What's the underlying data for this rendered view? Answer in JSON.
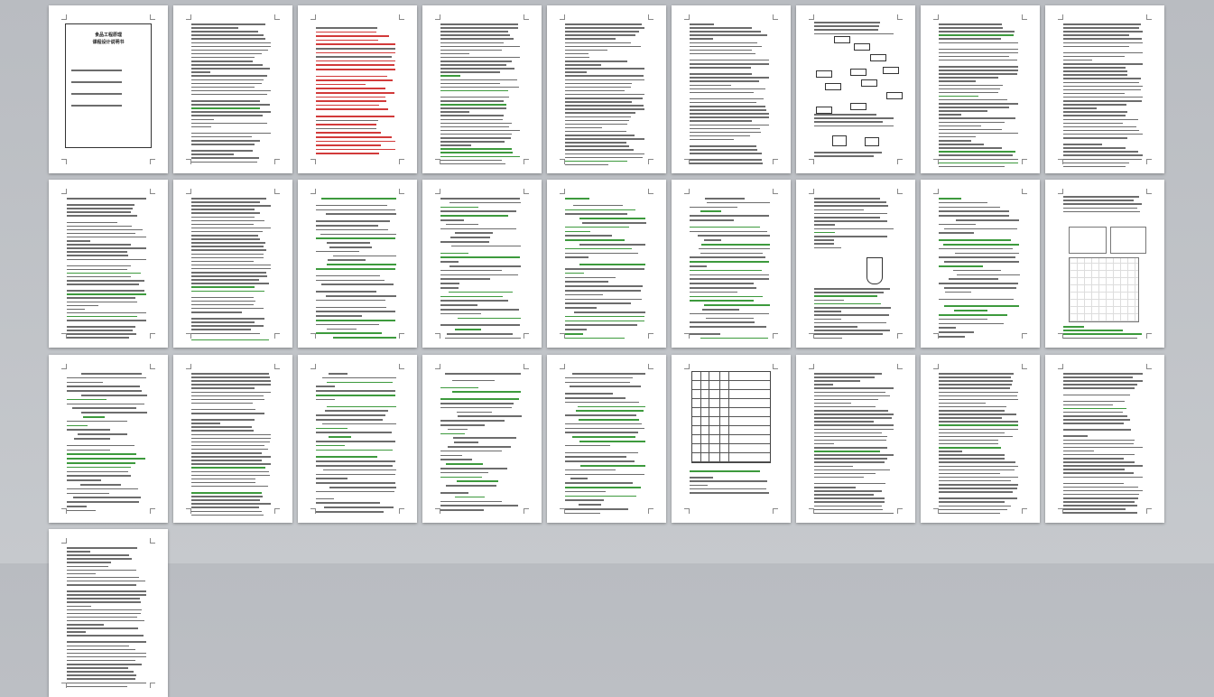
{
  "viewer": {
    "columns": 9,
    "page_count": 28
  },
  "pages": [
    {
      "kind": "cover",
      "title_lines": [
        "食品工程原理",
        "课程设计说明书"
      ]
    },
    {
      "kind": "text"
    },
    {
      "kind": "toc"
    },
    {
      "kind": "text"
    },
    {
      "kind": "text"
    },
    {
      "kind": "text"
    },
    {
      "kind": "flowchart"
    },
    {
      "kind": "text"
    },
    {
      "kind": "text"
    },
    {
      "kind": "text"
    },
    {
      "kind": "text"
    },
    {
      "kind": "formula"
    },
    {
      "kind": "formula"
    },
    {
      "kind": "formula"
    },
    {
      "kind": "formula"
    },
    {
      "kind": "diagram"
    },
    {
      "kind": "formula"
    },
    {
      "kind": "graph"
    },
    {
      "kind": "formula"
    },
    {
      "kind": "text"
    },
    {
      "kind": "formula"
    },
    {
      "kind": "formula"
    },
    {
      "kind": "formula"
    },
    {
      "kind": "table"
    },
    {
      "kind": "text"
    },
    {
      "kind": "text"
    },
    {
      "kind": "text"
    },
    {
      "kind": "text"
    }
  ]
}
